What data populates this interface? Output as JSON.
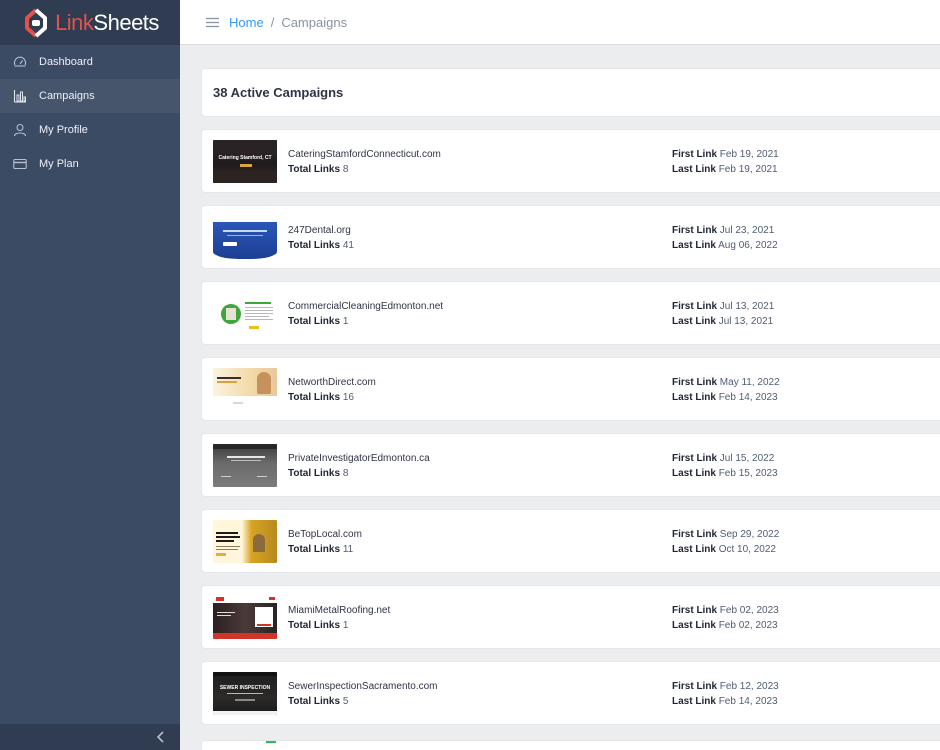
{
  "brand": {
    "name_part1": "Link",
    "name_part2": "Sheets",
    "accent": "#e0524a"
  },
  "sidebar": {
    "items": [
      {
        "label": "Dashboard",
        "icon": "speedometer-icon",
        "active": false
      },
      {
        "label": "Campaigns",
        "icon": "bar-chart-icon",
        "active": true
      },
      {
        "label": "My Profile",
        "icon": "user-icon",
        "active": false
      },
      {
        "label": "My Plan",
        "icon": "credit-card-icon",
        "active": false
      }
    ],
    "collapse_icon": "chevron-left-icon"
  },
  "breadcrumb": {
    "home": "Home",
    "separator": "/",
    "current": "Campaigns"
  },
  "page": {
    "title": "38 Active Campaigns"
  },
  "labels": {
    "total_links": "Total Links",
    "first_link": "First Link",
    "last_link": "Last Link"
  },
  "campaigns": [
    {
      "domain": "CateringStamfordConnecticut.com",
      "total_links": "8",
      "first_link": "Feb 19, 2021",
      "last_link": "Feb 19, 2021",
      "thumb_text": "Catering Stamford, CT"
    },
    {
      "domain": "247Dental.org",
      "total_links": "41",
      "first_link": "Jul 23, 2021",
      "last_link": "Aug 06, 2022",
      "thumb_text": ""
    },
    {
      "domain": "CommercialCleaningEdmonton.net",
      "total_links": "1",
      "first_link": "Jul 13, 2021",
      "last_link": "Jul 13, 2021",
      "thumb_text": ""
    },
    {
      "domain": "NetworthDirect.com",
      "total_links": "16",
      "first_link": "May 11, 2022",
      "last_link": "Feb 14, 2023",
      "thumb_text": ""
    },
    {
      "domain": "PrivateInvestigatorEdmonton.ca",
      "total_links": "8",
      "first_link": "Jul 15, 2022",
      "last_link": "Feb 15, 2023",
      "thumb_text": ""
    },
    {
      "domain": "BeTopLocal.com",
      "total_links": "11",
      "first_link": "Sep 29, 2022",
      "last_link": "Oct 10, 2022",
      "thumb_text": ""
    },
    {
      "domain": "MiamiMetalRoofing.net",
      "total_links": "1",
      "first_link": "Feb 02, 2023",
      "last_link": "Feb 02, 2023",
      "thumb_text": ""
    },
    {
      "domain": "SewerInspectionSacramento.com",
      "total_links": "5",
      "first_link": "Feb 12, 2023",
      "last_link": "Feb 14, 2023",
      "thumb_text": "SEWER INSPECTION"
    }
  ]
}
